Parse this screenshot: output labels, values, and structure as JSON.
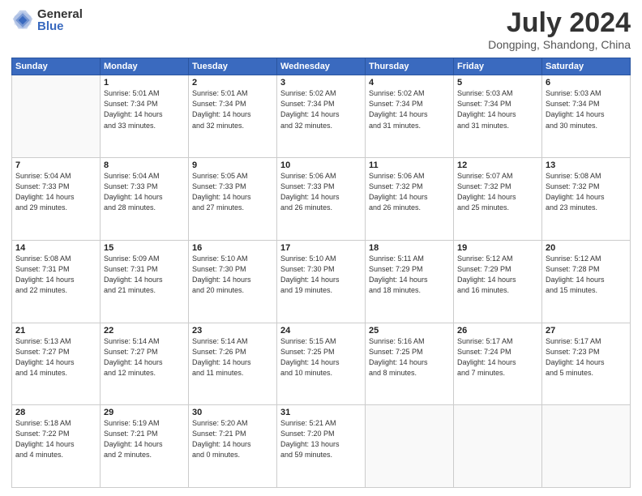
{
  "header": {
    "logo_general": "General",
    "logo_blue": "Blue",
    "month_year": "July 2024",
    "location": "Dongping, Shandong, China"
  },
  "weekdays": [
    "Sunday",
    "Monday",
    "Tuesday",
    "Wednesday",
    "Thursday",
    "Friday",
    "Saturday"
  ],
  "weeks": [
    [
      {
        "day": "",
        "info": ""
      },
      {
        "day": "1",
        "info": "Sunrise: 5:01 AM\nSunset: 7:34 PM\nDaylight: 14 hours\nand 33 minutes."
      },
      {
        "day": "2",
        "info": "Sunrise: 5:01 AM\nSunset: 7:34 PM\nDaylight: 14 hours\nand 32 minutes."
      },
      {
        "day": "3",
        "info": "Sunrise: 5:02 AM\nSunset: 7:34 PM\nDaylight: 14 hours\nand 32 minutes."
      },
      {
        "day": "4",
        "info": "Sunrise: 5:02 AM\nSunset: 7:34 PM\nDaylight: 14 hours\nand 31 minutes."
      },
      {
        "day": "5",
        "info": "Sunrise: 5:03 AM\nSunset: 7:34 PM\nDaylight: 14 hours\nand 31 minutes."
      },
      {
        "day": "6",
        "info": "Sunrise: 5:03 AM\nSunset: 7:34 PM\nDaylight: 14 hours\nand 30 minutes."
      }
    ],
    [
      {
        "day": "7",
        "info": "Sunrise: 5:04 AM\nSunset: 7:33 PM\nDaylight: 14 hours\nand 29 minutes."
      },
      {
        "day": "8",
        "info": "Sunrise: 5:04 AM\nSunset: 7:33 PM\nDaylight: 14 hours\nand 28 minutes."
      },
      {
        "day": "9",
        "info": "Sunrise: 5:05 AM\nSunset: 7:33 PM\nDaylight: 14 hours\nand 27 minutes."
      },
      {
        "day": "10",
        "info": "Sunrise: 5:06 AM\nSunset: 7:33 PM\nDaylight: 14 hours\nand 26 minutes."
      },
      {
        "day": "11",
        "info": "Sunrise: 5:06 AM\nSunset: 7:32 PM\nDaylight: 14 hours\nand 26 minutes."
      },
      {
        "day": "12",
        "info": "Sunrise: 5:07 AM\nSunset: 7:32 PM\nDaylight: 14 hours\nand 25 minutes."
      },
      {
        "day": "13",
        "info": "Sunrise: 5:08 AM\nSunset: 7:32 PM\nDaylight: 14 hours\nand 23 minutes."
      }
    ],
    [
      {
        "day": "14",
        "info": "Sunrise: 5:08 AM\nSunset: 7:31 PM\nDaylight: 14 hours\nand 22 minutes."
      },
      {
        "day": "15",
        "info": "Sunrise: 5:09 AM\nSunset: 7:31 PM\nDaylight: 14 hours\nand 21 minutes."
      },
      {
        "day": "16",
        "info": "Sunrise: 5:10 AM\nSunset: 7:30 PM\nDaylight: 14 hours\nand 20 minutes."
      },
      {
        "day": "17",
        "info": "Sunrise: 5:10 AM\nSunset: 7:30 PM\nDaylight: 14 hours\nand 19 minutes."
      },
      {
        "day": "18",
        "info": "Sunrise: 5:11 AM\nSunset: 7:29 PM\nDaylight: 14 hours\nand 18 minutes."
      },
      {
        "day": "19",
        "info": "Sunrise: 5:12 AM\nSunset: 7:29 PM\nDaylight: 14 hours\nand 16 minutes."
      },
      {
        "day": "20",
        "info": "Sunrise: 5:12 AM\nSunset: 7:28 PM\nDaylight: 14 hours\nand 15 minutes."
      }
    ],
    [
      {
        "day": "21",
        "info": "Sunrise: 5:13 AM\nSunset: 7:27 PM\nDaylight: 14 hours\nand 14 minutes."
      },
      {
        "day": "22",
        "info": "Sunrise: 5:14 AM\nSunset: 7:27 PM\nDaylight: 14 hours\nand 12 minutes."
      },
      {
        "day": "23",
        "info": "Sunrise: 5:14 AM\nSunset: 7:26 PM\nDaylight: 14 hours\nand 11 minutes."
      },
      {
        "day": "24",
        "info": "Sunrise: 5:15 AM\nSunset: 7:25 PM\nDaylight: 14 hours\nand 10 minutes."
      },
      {
        "day": "25",
        "info": "Sunrise: 5:16 AM\nSunset: 7:25 PM\nDaylight: 14 hours\nand 8 minutes."
      },
      {
        "day": "26",
        "info": "Sunrise: 5:17 AM\nSunset: 7:24 PM\nDaylight: 14 hours\nand 7 minutes."
      },
      {
        "day": "27",
        "info": "Sunrise: 5:17 AM\nSunset: 7:23 PM\nDaylight: 14 hours\nand 5 minutes."
      }
    ],
    [
      {
        "day": "28",
        "info": "Sunrise: 5:18 AM\nSunset: 7:22 PM\nDaylight: 14 hours\nand 4 minutes."
      },
      {
        "day": "29",
        "info": "Sunrise: 5:19 AM\nSunset: 7:21 PM\nDaylight: 14 hours\nand 2 minutes."
      },
      {
        "day": "30",
        "info": "Sunrise: 5:20 AM\nSunset: 7:21 PM\nDaylight: 14 hours\nand 0 minutes."
      },
      {
        "day": "31",
        "info": "Sunrise: 5:21 AM\nSunset: 7:20 PM\nDaylight: 13 hours\nand 59 minutes."
      },
      {
        "day": "",
        "info": ""
      },
      {
        "day": "",
        "info": ""
      },
      {
        "day": "",
        "info": ""
      }
    ]
  ]
}
